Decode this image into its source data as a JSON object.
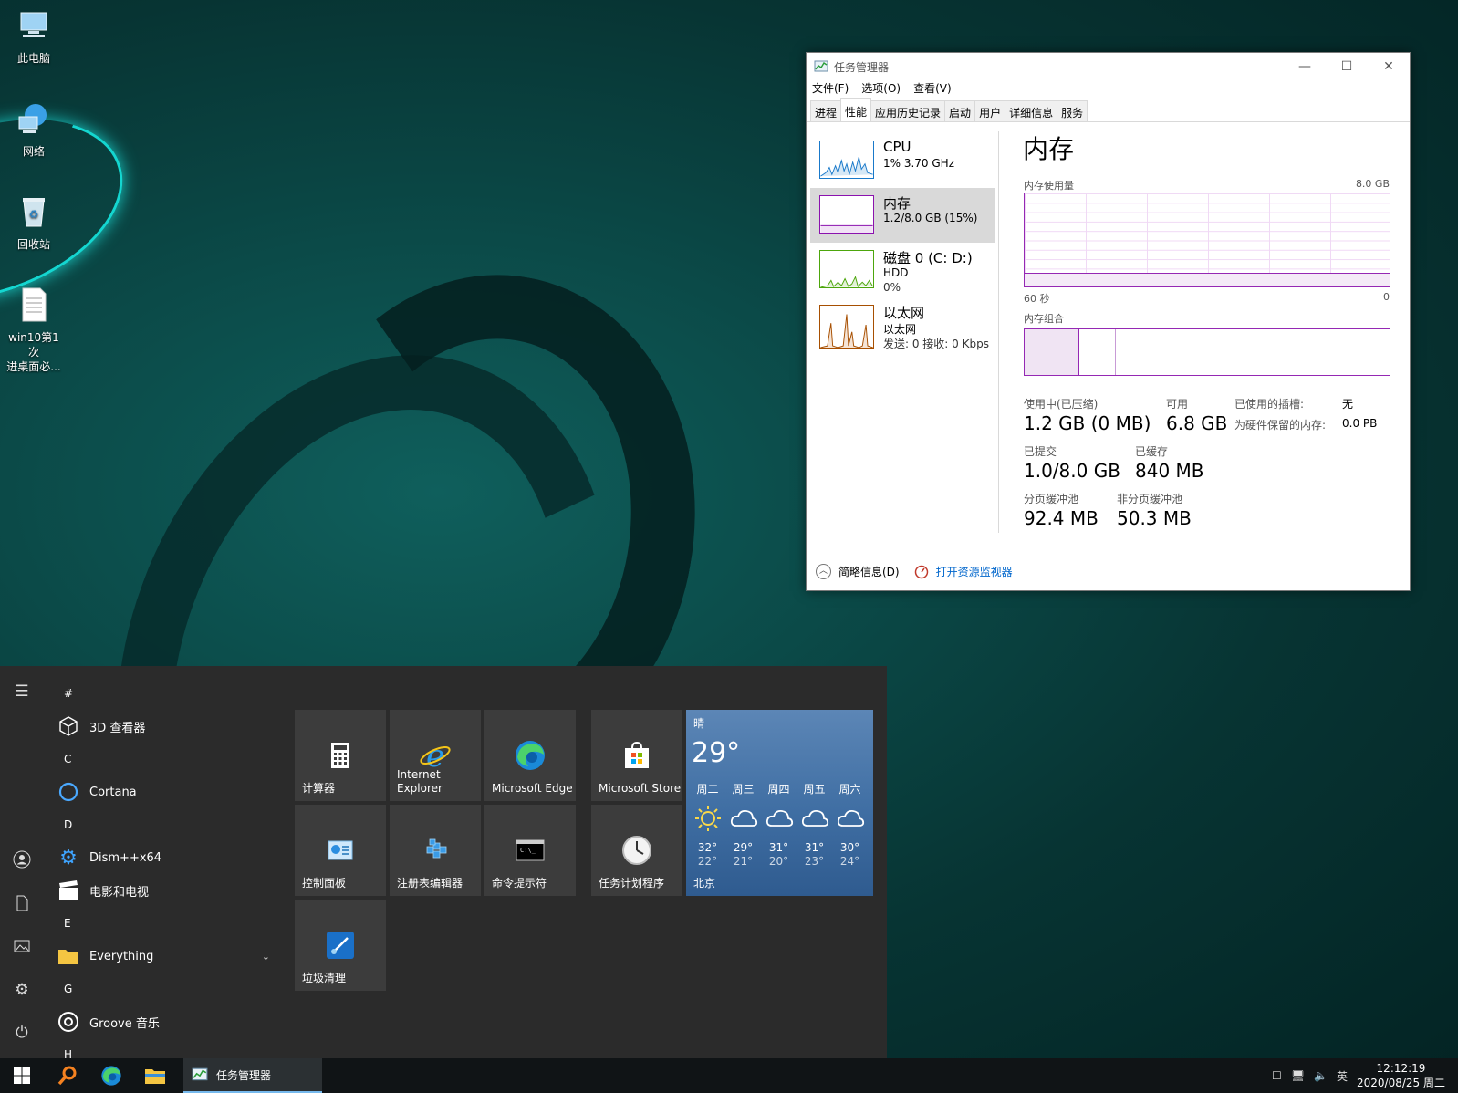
{
  "desktop": {
    "icons": [
      {
        "label": "此电脑"
      },
      {
        "label": "网络"
      },
      {
        "label": "回收站"
      },
      {
        "label_line1": "win10第1次",
        "label_line2": "进桌面必..."
      }
    ]
  },
  "task_manager": {
    "title": "任务管理器",
    "window_controls": {
      "minimize": "—",
      "maximize": "☐",
      "close": "✕"
    },
    "menu": [
      "文件(F)",
      "选项(O)",
      "查看(V)"
    ],
    "tabs": [
      "进程",
      "性能",
      "应用历史记录",
      "启动",
      "用户",
      "详细信息",
      "服务"
    ],
    "active_tab": "性能",
    "sidebar": [
      {
        "name": "CPU",
        "line1": "1% 3.70 GHz",
        "line2": "",
        "color": "#1979ca"
      },
      {
        "name": "内存",
        "line1": "1.2/8.0 GB (15%)",
        "line2": "",
        "color": "#8b12ae"
      },
      {
        "name": "磁盘 0 (C: D:)",
        "line1": "HDD",
        "line2": "0%",
        "color": "#4da60c"
      },
      {
        "name": "以太网",
        "line1": "以太网",
        "line2": "发送: 0 接收: 0 Kbps",
        "color": "#a74f01"
      }
    ],
    "memory": {
      "heading": "内存",
      "usage_label": "内存使用量",
      "max_label": "8.0 GB",
      "time_left": "60 秒",
      "time_right": "0",
      "composition_label": "内存组合",
      "in_use_label": "使用中(已压缩)",
      "in_use_value": "1.2 GB (0 MB)",
      "available_label": "可用",
      "available_value": "6.8 GB",
      "slots_label": "已使用的插槽:",
      "slots_value": "无",
      "reserved_label": "为硬件保留的内存:",
      "reserved_value": "0.0 PB",
      "committed_label": "已提交",
      "committed_value": "1.0/8.0 GB",
      "cached_label": "已缓存",
      "cached_value": "840 MB",
      "paged_label": "分页缓冲池",
      "paged_value": "92.4 MB",
      "nonpaged_label": "非分页缓冲池",
      "nonpaged_value": "50.3 MB",
      "usage_fraction": 0.15
    },
    "footer": {
      "less_details": "简略信息(D)",
      "resource_monitor": "打开资源监视器"
    }
  },
  "start_menu": {
    "app_list": [
      {
        "type": "group",
        "label": "#"
      },
      {
        "type": "app",
        "label": "3D 查看器",
        "icon": "cube-icon"
      },
      {
        "type": "group",
        "label": "C"
      },
      {
        "type": "app",
        "label": "Cortana",
        "icon": "cortana-icon"
      },
      {
        "type": "group",
        "label": "D"
      },
      {
        "type": "app",
        "label": "Dism++x64",
        "icon": "gear-icon"
      },
      {
        "type": "app",
        "label": "电影和电视",
        "icon": "clapper-icon"
      },
      {
        "type": "group",
        "label": "E"
      },
      {
        "type": "app",
        "label": "Everything",
        "icon": "folder-icon",
        "expandable": true
      },
      {
        "type": "group",
        "label": "G"
      },
      {
        "type": "app",
        "label": "Groove 音乐",
        "icon": "groove-icon"
      },
      {
        "type": "group",
        "label": "H"
      }
    ],
    "tiles": [
      {
        "label": "计算器",
        "icon": "calculator-icon"
      },
      {
        "label_line1": "Internet",
        "label_line2": "Explorer",
        "icon": "ie-icon"
      },
      {
        "label": "Microsoft Edge",
        "icon": "edge-icon"
      },
      {
        "label": "Microsoft Store",
        "icon": "store-icon"
      },
      {
        "label": "控制面板",
        "icon": "control-panel-icon"
      },
      {
        "label": "注册表编辑器",
        "icon": "regedit-icon"
      },
      {
        "label": "命令提示符",
        "icon": "cmd-icon"
      },
      {
        "label": "任务计划程序",
        "icon": "clock-icon"
      },
      {
        "label": "垃圾清理",
        "icon": "cleaner-icon"
      }
    ],
    "weather": {
      "condition": "晴",
      "temp": "29°",
      "city": "北京",
      "forecast": [
        {
          "day": "周二",
          "icon": "sun-icon",
          "hi": "32°",
          "lo": "22°"
        },
        {
          "day": "周三",
          "icon": "cloud-icon",
          "hi": "29°",
          "lo": "21°"
        },
        {
          "day": "周四",
          "icon": "cloud-icon",
          "hi": "31°",
          "lo": "20°"
        },
        {
          "day": "周五",
          "icon": "cloud-icon",
          "hi": "31°",
          "lo": "23°"
        },
        {
          "day": "周六",
          "icon": "cloud-icon",
          "hi": "30°",
          "lo": "24°"
        }
      ]
    }
  },
  "taskbar": {
    "running_app": "任务管理器",
    "ime": "英",
    "time": "12:12:19",
    "date": "2020/08/25 周二"
  }
}
